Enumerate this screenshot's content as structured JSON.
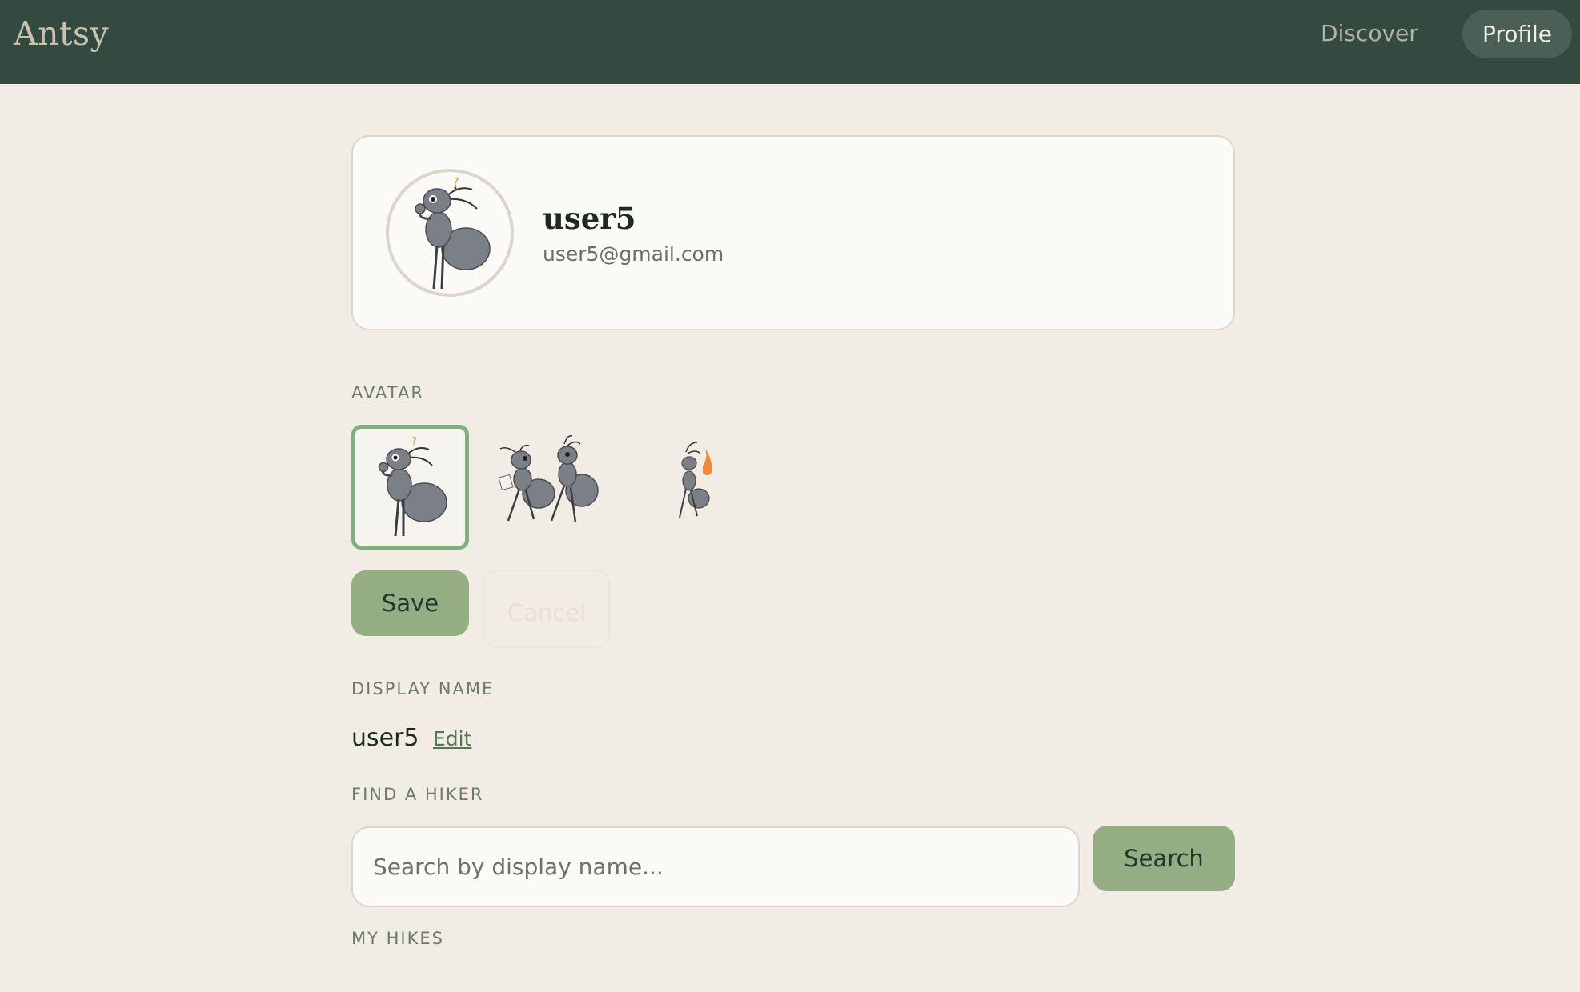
{
  "header": {
    "brand": "Antsy",
    "nav": {
      "discover": "Discover",
      "profile": "Profile"
    },
    "background": "#344a40"
  },
  "profile": {
    "name": "user5",
    "email": "user5@gmail.com"
  },
  "avatar_section": {
    "label": "AVATAR",
    "options": [
      {
        "icon": "thinking-ant-icon",
        "selected": true
      },
      {
        "icon": "two-ants-walking-icon",
        "selected": false
      },
      {
        "icon": "ant-with-flame-icon",
        "selected": false
      }
    ],
    "save_label": "Save",
    "cancel_label": "Cancel"
  },
  "display_name_section": {
    "label": "DISPLAY NAME",
    "value": "user5",
    "edit_label": "Edit"
  },
  "find_hiker": {
    "label": "FIND A HIKER",
    "placeholder": "Search by display name...",
    "button": "Search"
  },
  "my_hikes": {
    "label": "MY HIKES"
  },
  "colors": {
    "accent": "#94ad82",
    "selected_border": "#7fb07e",
    "page_bg": "#f1ece4"
  }
}
